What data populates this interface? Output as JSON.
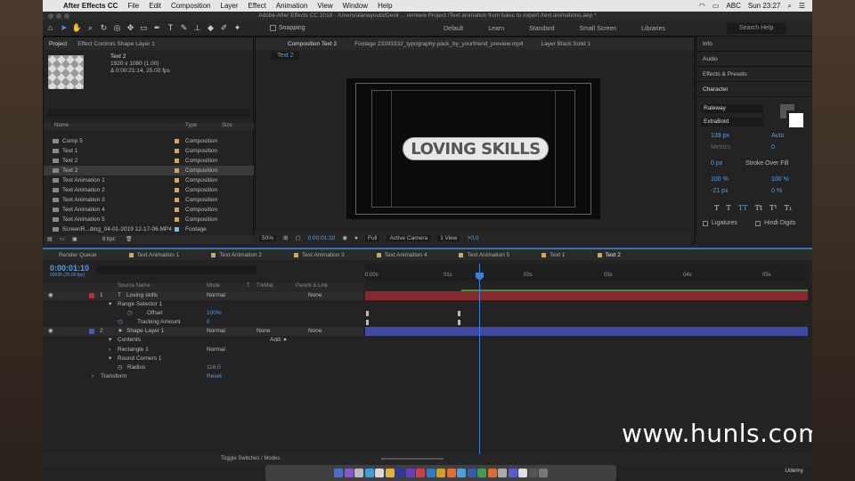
{
  "menubar": {
    "app": "After Effects CC",
    "items": [
      "File",
      "Edit",
      "Composition",
      "Layer",
      "Effect",
      "Animation",
      "View",
      "Window",
      "Help"
    ],
    "status": {
      "abc": "ABC",
      "clock": "Sun 23:27"
    }
  },
  "window_title": "Adobe After Effects CC 2019 - /Users/alanayoubi/Desk ... remiere Project /Text animation from baisc to expert /text animations.aep *",
  "toolbar": {
    "snapping": "Snapping",
    "workspaces": [
      "Default",
      "Learn",
      "Standard",
      "Small Screen",
      "Libraries"
    ],
    "search_placeholder": "Search Help"
  },
  "project_panel": {
    "tabs": [
      "Project",
      "Effect Controls Shape Layer 1"
    ],
    "selected_name": "Text 2",
    "meta1": "1920 x 1080 (1.00)",
    "meta2": "Δ 0:00:21:14, 25.00 fps",
    "headers": {
      "name": "Name",
      "type": "Type",
      "size": "Size"
    },
    "items": [
      {
        "name": "Comp 5",
        "type": "Composition"
      },
      {
        "name": "Text 1",
        "type": "Composition"
      },
      {
        "name": "Text 2",
        "type": "Composition"
      },
      {
        "name": "Text 2",
        "type": "Composition",
        "selected": true
      },
      {
        "name": "Text Animation 1",
        "type": "Composition"
      },
      {
        "name": "Text Animation 2",
        "type": "Composition"
      },
      {
        "name": "Text Animation 3",
        "type": "Composition"
      },
      {
        "name": "Text Animation 4",
        "type": "Composition"
      },
      {
        "name": "Text Animation 5",
        "type": "Composition"
      },
      {
        "name": "ScreenR...ding_04-01-2019 12-17-06.MP4",
        "type": "Footage"
      }
    ],
    "bpc": "8 bpc"
  },
  "viewer": {
    "tabs": [
      "Composition Text 2",
      "Footage 23393332_typography-pack_by_yourfriend_preview.mp4",
      "Layer Black Solid 1"
    ],
    "subtab": "Text 2",
    "preview_text": "LOVING SKILLS",
    "bar": {
      "zoom": "50%",
      "timecode": "0:00:01:10",
      "resolution": "Full",
      "camera": "Active Camera",
      "views": "1 View",
      "exposure": "+0,0"
    }
  },
  "right_panel": {
    "sections": [
      "Info",
      "Audio",
      "Effects & Presets",
      "Character"
    ],
    "font": "Raleway",
    "style": "ExtraBold",
    "size": "139 px",
    "leading": "Auto",
    "kerning": "Metrics",
    "tracking": "0",
    "stroke": "0 px",
    "stroke_mode": "Stroke Over Fill",
    "vscale": "100 %",
    "hscale": "100 %",
    "baseline": "-21 px",
    "tsume": "0 %",
    "ligatures": "Ligatures",
    "hindi": "Hindi Digits"
  },
  "timeline": {
    "tabs": [
      "Render Queue",
      "Text Animation 1",
      "Text Animation 2",
      "Text Animation 3",
      "Text Animation 4",
      "Text Animation 5",
      "Text 1",
      "Text 2"
    ],
    "timecode": "0:00:01:10",
    "timecode_sub": "00035 (25.00 fps)",
    "headers": {
      "source": "Source Name",
      "mode": "Mode",
      "t": "T",
      "trkmat": "TrkMat",
      "parent": "Parent & Link"
    },
    "rows": [
      {
        "n": "1",
        "name": "Loving skills",
        "mode": "Normal",
        "parent": "None"
      },
      {
        "name": "Range Selector 1"
      },
      {
        "name": "Offset",
        "value": "100%"
      },
      {
        "name": "Tracking Amount",
        "value": "0"
      },
      {
        "n": "2",
        "name": "Shape Layer 1",
        "mode": "Normal",
        "trk": "None",
        "parent": "None"
      },
      {
        "name": "Contents",
        "add": "Add:"
      },
      {
        "name": "Rectangle 1",
        "mode": "Normal"
      },
      {
        "name": "Round Corners 1"
      },
      {
        "name": "Radius",
        "value": "116,0"
      },
      {
        "name": "Transform",
        "value": "Reset"
      }
    ],
    "ruler": [
      "0:00s",
      "01s",
      "02s",
      "03s",
      "04s",
      "05s"
    ],
    "toggle": "Toggle Switches / Modes"
  },
  "watermark": "www.hunls.com",
  "udemy": "Udemy",
  "colors": {
    "accent": "#3d7ed6",
    "layer1": "#b03038",
    "layer2": "#4a55b0"
  }
}
